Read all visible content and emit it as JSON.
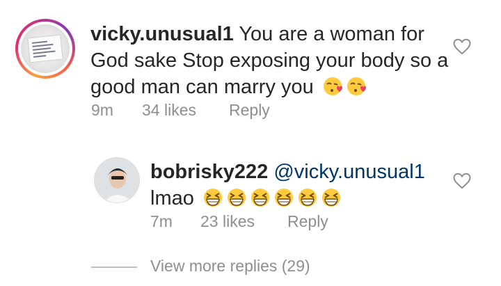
{
  "comment": {
    "username": "vicky.unusual1",
    "text": "You are a woman for God sake Stop exposing your body so a good man can marry you",
    "emojis": [
      "kissing-face-with-heart",
      "kissing-face-with-heart"
    ],
    "time": "9m",
    "likes": "34 likes",
    "reply_label": "Reply"
  },
  "reply": {
    "username": "bobrisky222",
    "mention": "@vicky.unusual1",
    "text": "lmao",
    "emojis": [
      "grinning-squinting-face",
      "grinning-squinting-face",
      "grinning-squinting-face",
      "grinning-squinting-face",
      "grinning-squinting-face",
      "grinning-squinting-face"
    ],
    "time": "7m",
    "likes": "23 likes",
    "reply_label": "Reply"
  },
  "view_more": "View more replies (29)",
  "colors": {
    "text": "#262626",
    "meta": "#8e8e8e",
    "mention": "#003569",
    "heart_outline": "#8e8e8e",
    "ring": [
      "#f9a03f",
      "#e1306c",
      "#c13584",
      "#833ab4"
    ]
  },
  "icons": [
    "heart-outline-icon"
  ]
}
